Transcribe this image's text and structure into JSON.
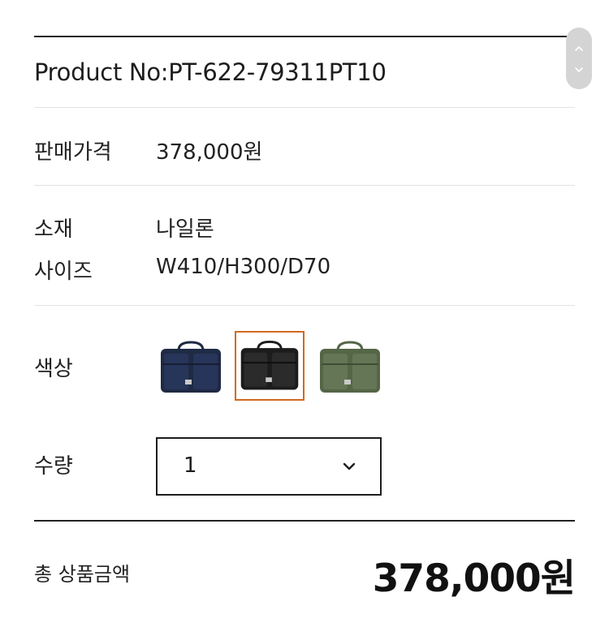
{
  "product": {
    "number": "Product No:PT-622-79311PT10"
  },
  "price_row": {
    "label": "판매가격",
    "value": "378,000원"
  },
  "material_row": {
    "label": "소재",
    "value": "나일론"
  },
  "size_row": {
    "label": "사이즈",
    "value": "W410/H300/D70"
  },
  "color_row": {
    "label": "색상",
    "options": [
      {
        "name": "navy",
        "color": "#1f2a44",
        "selected": false
      },
      {
        "name": "black",
        "color": "#1c1c1c",
        "selected": true
      },
      {
        "name": "olive",
        "color": "#556647",
        "selected": false
      }
    ],
    "selected_border_color": "#d2691e"
  },
  "quantity_row": {
    "label": "수량",
    "value": "1",
    "icon": "chevron-down-icon"
  },
  "total": {
    "label": "총 상품금액",
    "value": "378,000원"
  },
  "scrollbar": {
    "up_icon": "chevron-up-icon",
    "down_icon": "chevron-down-icon"
  }
}
